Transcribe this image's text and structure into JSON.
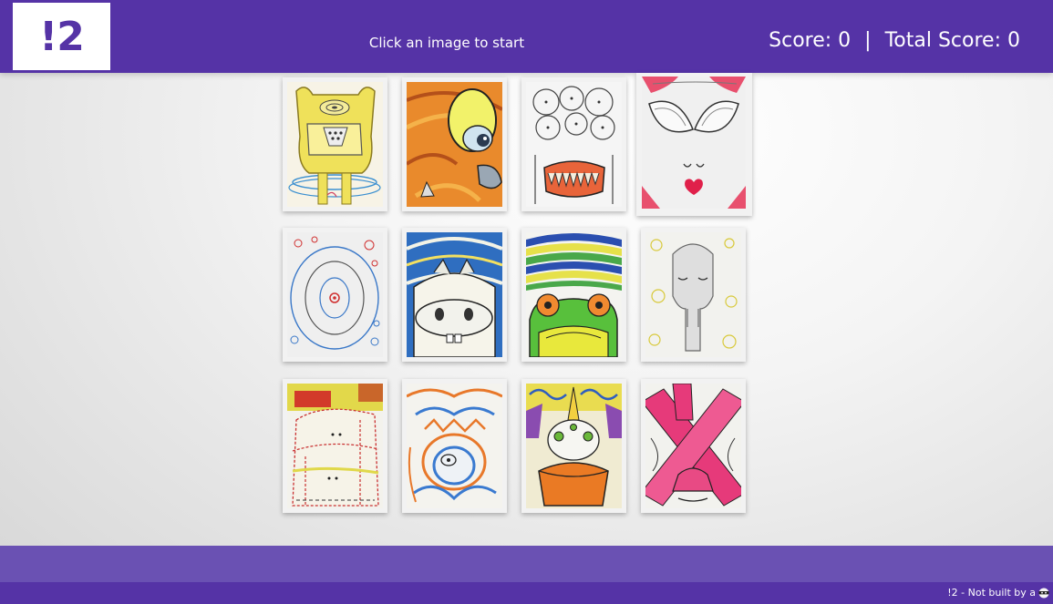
{
  "header": {
    "logo": "!2",
    "message": "Click an image to start",
    "score_label": "Score: 0",
    "separator": "|",
    "total_label": "Total Score: 0"
  },
  "cards": [
    {
      "name": "card-yellow-creature"
    },
    {
      "name": "card-orange-cyclops"
    },
    {
      "name": "card-bubbly-teeth-monster"
    },
    {
      "name": "card-heart-lips-face"
    },
    {
      "name": "card-concentric-eye"
    },
    {
      "name": "card-blue-hippo"
    },
    {
      "name": "card-green-frog-stripes"
    },
    {
      "name": "card-sleepy-ghost"
    },
    {
      "name": "card-stitched-quilt"
    },
    {
      "name": "card-orange-blue-swirls"
    },
    {
      "name": "card-unicorn-cauldron"
    },
    {
      "name": "card-pink-crossed-bands"
    }
  ],
  "footer": {
    "text": "!2 - Not built by a",
    "icon": "ninja-icon"
  },
  "colors": {
    "header": "#5533a6",
    "footer_band": "#6a51b3",
    "accent": "#5533a6"
  }
}
